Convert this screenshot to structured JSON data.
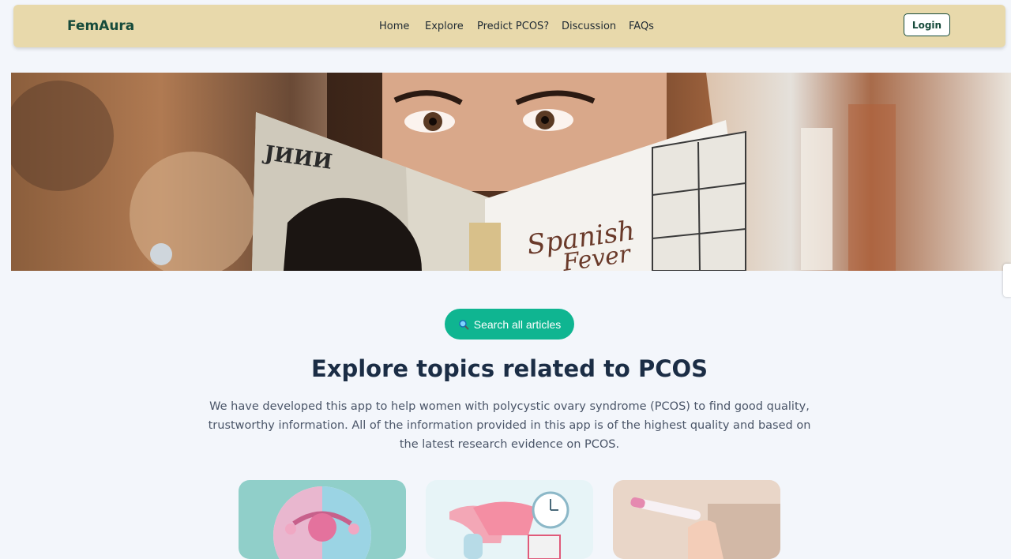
{
  "navbar": {
    "brand": "FemAura",
    "links": [
      "Home",
      "Explore",
      "Predict PCOS?",
      "Discussion",
      "FAQs"
    ],
    "login_label": "Login"
  },
  "hero": {
    "book_title": "Spanish Fever"
  },
  "search": {
    "label": "Search all articles",
    "icon": "search-icon"
  },
  "section": {
    "title": "Explore topics related to PCOS",
    "intro": "We have developed this app to help women with polycystic ovary syndrome (PCOS) to find good quality, trustworthy information. All of the information provided in this app is of the highest quality and based on the latest research evidence on PCOS."
  },
  "colors": {
    "navbar": "#e8d9ab",
    "brand": "#174b3b",
    "accent": "#0fb591",
    "title": "#1b2d45"
  }
}
